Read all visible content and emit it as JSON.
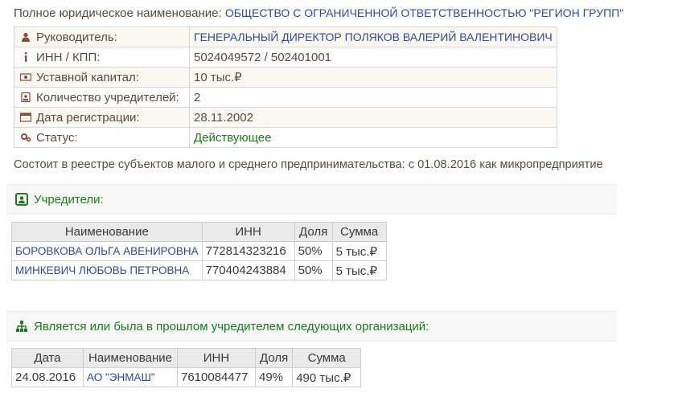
{
  "company": {
    "full_name_label": "Полное юридическое наименование:",
    "full_name_value": "ОБЩЕСТВО С ОГРАНИЧЕННОЙ ОТВЕТСТВЕННОСТЬЮ \"РЕГИОН ГРУПП\"",
    "fields": [
      {
        "icon": "person-icon",
        "label": "Руководитель:",
        "value": "ГЕНЕРАЛЬНЫЙ ДИРЕКТОР ПОЛЯКОВ ВАЛЕРИЙ ВАЛЕНТИНОВИЧ"
      },
      {
        "icon": "info-icon",
        "label": "ИНН / КПП:",
        "value": "5024049572 / 502401001"
      },
      {
        "icon": "money-icon",
        "label": "Уставной капитал:",
        "value": "10 тыс.₽"
      },
      {
        "icon": "id-badge-icon",
        "label": "Количество учредителей:",
        "value": "2"
      },
      {
        "icon": "calendar-card-icon",
        "label": "Дата регистрации:",
        "value": "28.11.2002"
      },
      {
        "icon": "gears-icon",
        "label": "Статус:",
        "value": "Действующее"
      }
    ],
    "sme_note": "Состоит в реестре субъектов малого и среднего предпринимательства: с 01.08.2016 как микропредприятие"
  },
  "founders": {
    "title": "Учредители:",
    "headers": [
      "Наименование",
      "ИНН",
      "Доля",
      "Сумма"
    ],
    "rows": [
      [
        "БОРОВКОВА ОЛЬГА АВЕНИРОВНА",
        "772814323216",
        "50%",
        "5 тыс.₽"
      ],
      [
        "МИНКЕВИЧ ЛЮБОВЬ ПЕТРОВНА",
        "770404243884",
        "50%",
        "5 тыс.₽"
      ]
    ]
  },
  "orgs": {
    "title": "Является или была в прошлом учредителем следующих организаций:",
    "headers": [
      "Дата",
      "Наименование",
      "ИНН",
      "Доля",
      "Сумма"
    ],
    "rows": [
      [
        "24.08.2016",
        "АО \"ЭНМАШ\"",
        "7610084477",
        "49%",
        "490 тыс.₽"
      ]
    ]
  },
  "colors": {
    "link": "#2b4aa3",
    "status_green": "#1a7d1a",
    "text": "#5a4a3a"
  }
}
